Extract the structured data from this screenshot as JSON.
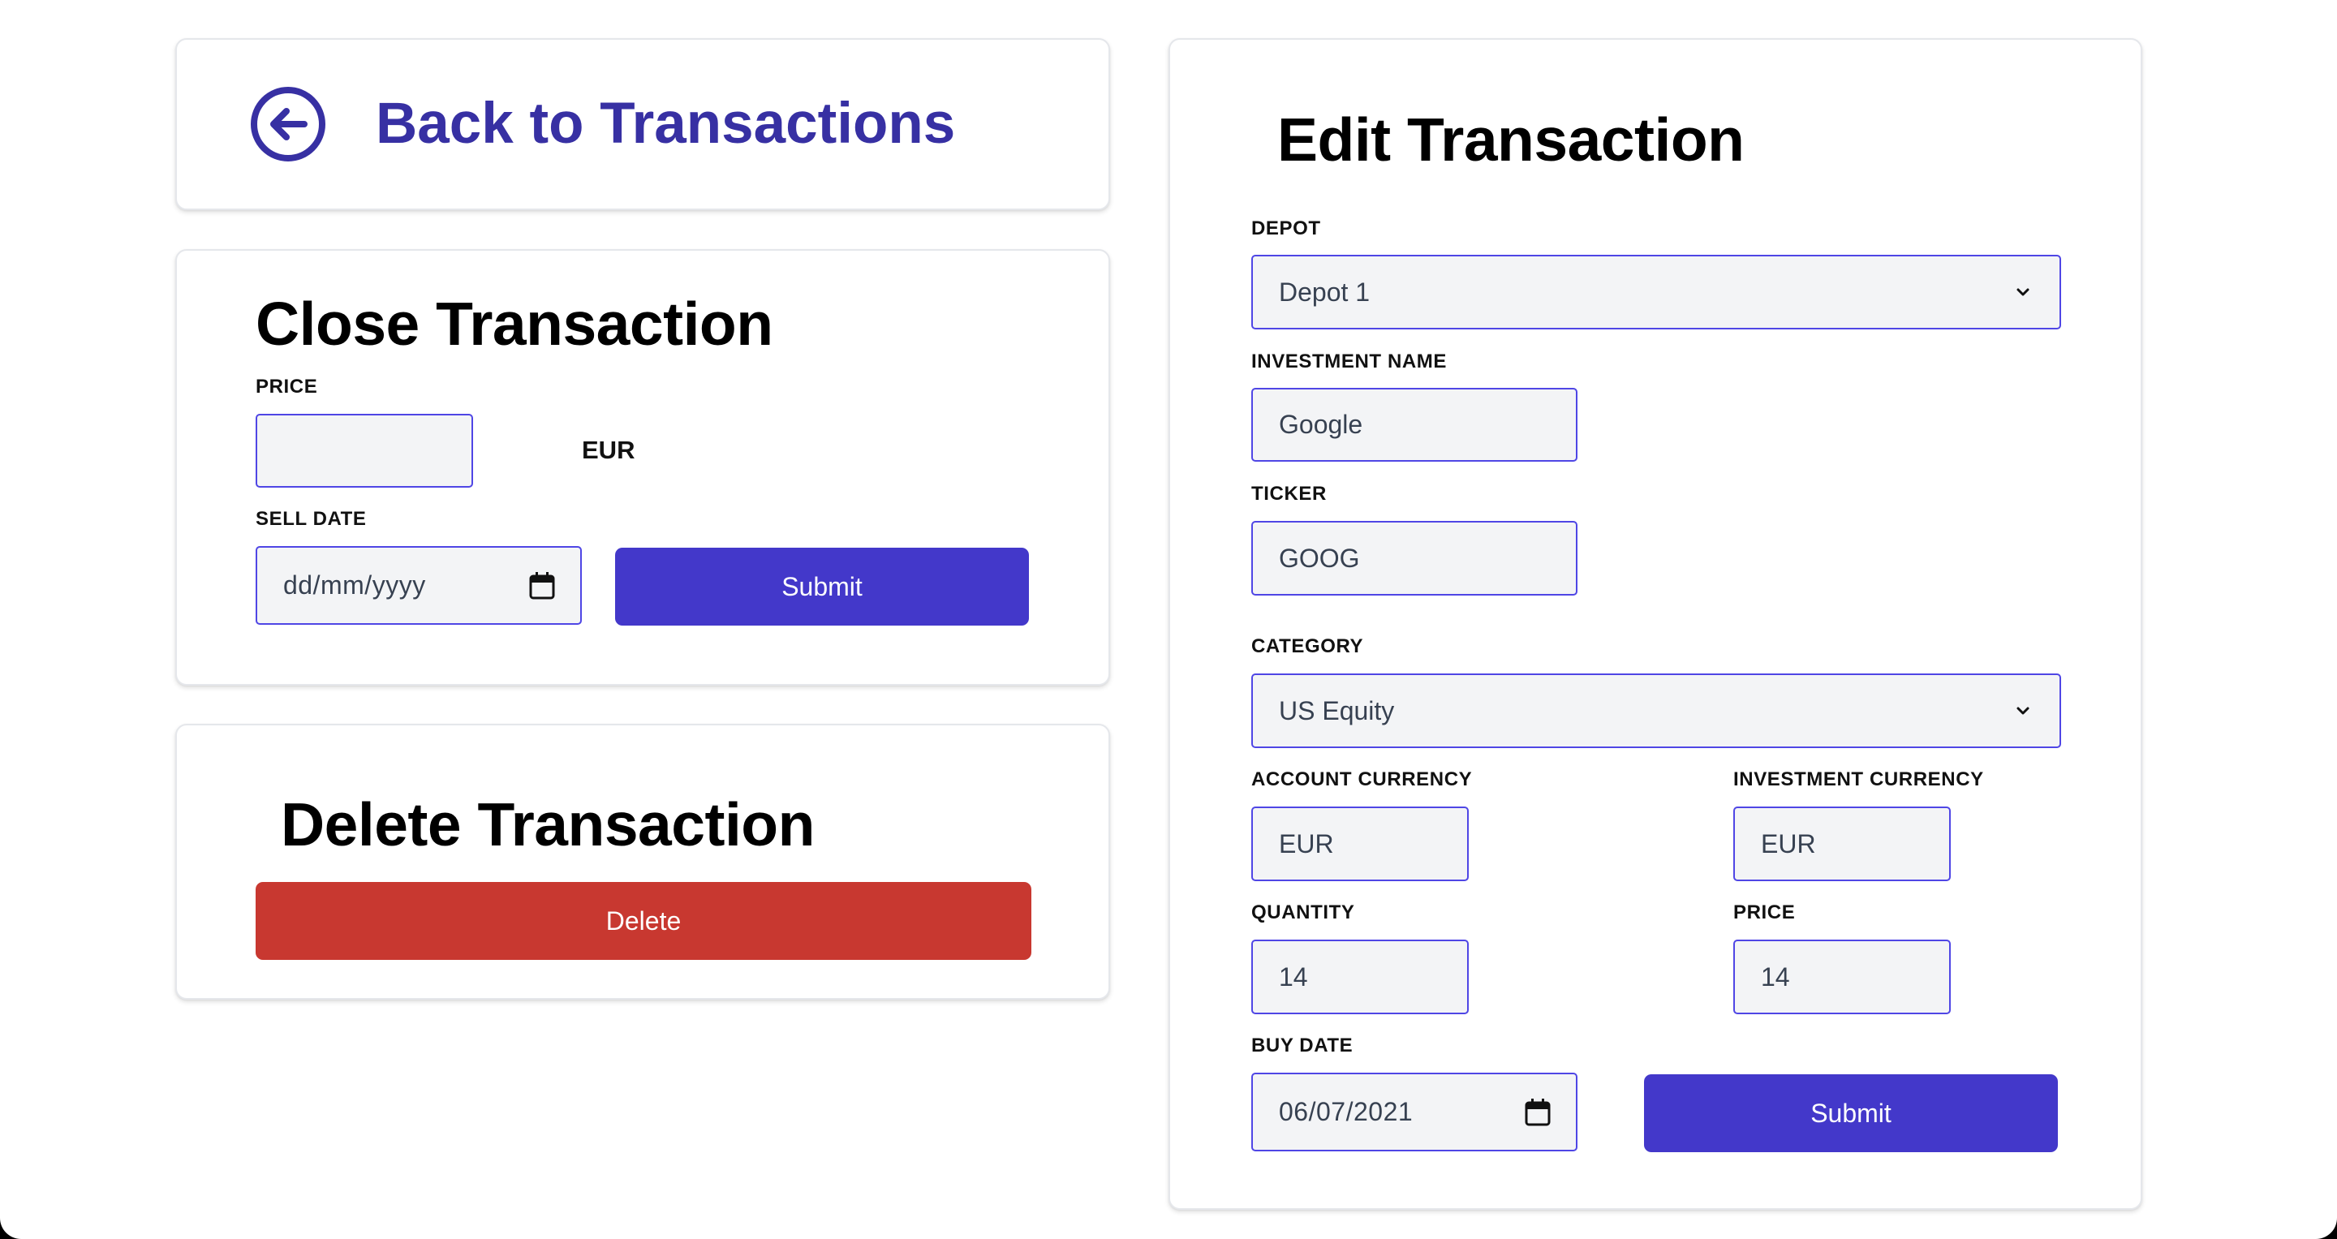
{
  "back": {
    "label": "Back to Transactions"
  },
  "close_transaction": {
    "title": "Close Transaction",
    "price_label": "PRICE",
    "price_value": "",
    "currency": "EUR",
    "sell_date_label": "SELL DATE",
    "sell_date_placeholder": "dd/mm/yyyy",
    "submit_label": "Submit"
  },
  "delete_transaction": {
    "title": "Delete Transaction",
    "delete_label": "Delete"
  },
  "edit_transaction": {
    "title": "Edit Transaction",
    "depot_label": "DEPOT",
    "depot_value": "Depot 1",
    "investment_name_label": "INVESTMENT NAME",
    "investment_name_value": "Google",
    "ticker_label": "TICKER",
    "ticker_value": "GOOG",
    "category_label": "CATEGORY",
    "category_value": "US Equity",
    "account_currency_label": "ACCOUNT CURRENCY",
    "account_currency_value": "EUR",
    "investment_currency_label": "INVESTMENT CURRENCY",
    "investment_currency_value": "EUR",
    "quantity_label": "QUANTITY",
    "quantity_value": "14",
    "price_label": "PRICE",
    "price_value": "14",
    "buy_date_label": "BUY DATE",
    "buy_date_value": "06/07/2021",
    "submit_label": "Submit"
  },
  "colors": {
    "primary": "#4338ca",
    "back_link": "#3730a3",
    "danger": "#c83830",
    "field_border": "#4f46e5",
    "field_bg": "#f3f4f6"
  },
  "icons": [
    "arrow-left-circle-icon",
    "chevron-down-icon",
    "calendar-icon"
  ]
}
